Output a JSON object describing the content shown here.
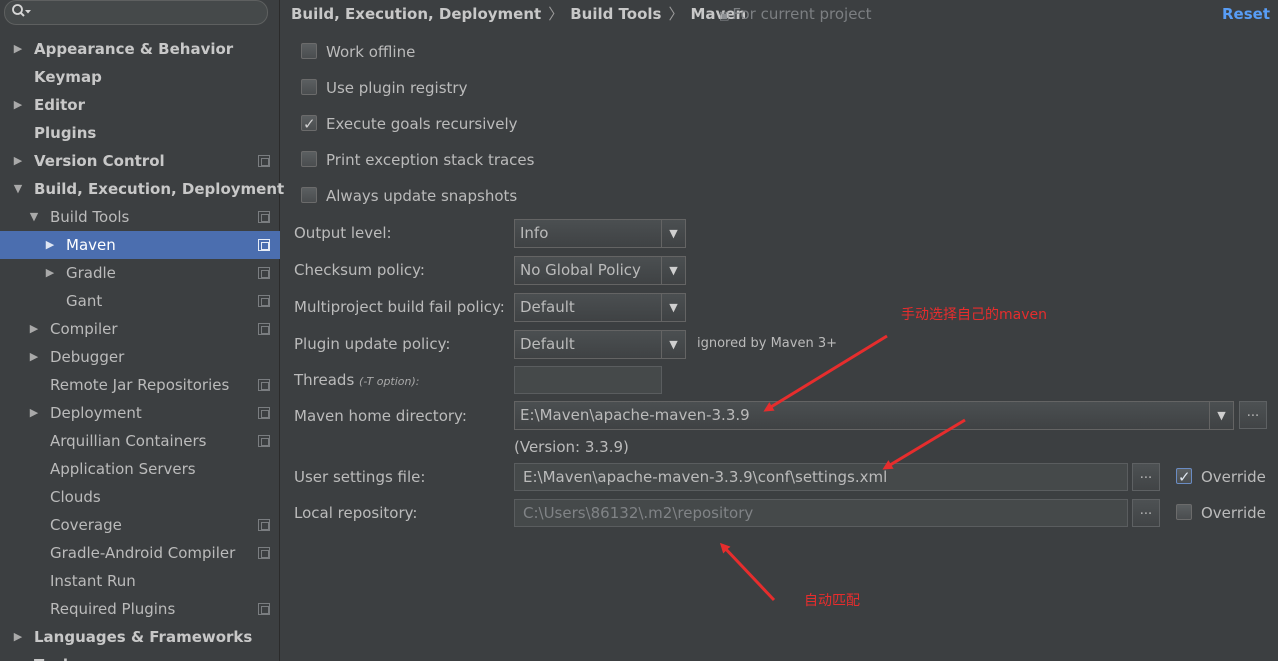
{
  "sidebar": {
    "search": {
      "value": ""
    },
    "items": [
      {
        "label": "Appearance & Behavior",
        "arrow": "▶",
        "bold": true
      },
      {
        "label": "Keymap",
        "arrow": "",
        "bold": true
      },
      {
        "label": "Editor",
        "arrow": "▶",
        "bold": true
      },
      {
        "label": "Plugins",
        "arrow": "",
        "bold": true
      },
      {
        "label": "Version Control",
        "arrow": "▶",
        "bold": true
      },
      {
        "label": "Build, Execution, Deployment",
        "arrow": "▼",
        "bold": true
      },
      {
        "label": "Build Tools",
        "arrow": "▼",
        "bold": false
      },
      {
        "label": "Maven",
        "arrow": "▶",
        "bold": false
      },
      {
        "label": "Gradle",
        "arrow": "▶",
        "bold": false
      },
      {
        "label": "Gant",
        "arrow": "",
        "bold": false
      },
      {
        "label": "Compiler",
        "arrow": "▶",
        "bold": false
      },
      {
        "label": "Debugger",
        "arrow": "▶",
        "bold": false
      },
      {
        "label": "Remote Jar Repositories",
        "arrow": "",
        "bold": false
      },
      {
        "label": "Deployment",
        "arrow": "▶",
        "bold": false
      },
      {
        "label": "Arquillian Containers",
        "arrow": "",
        "bold": false
      },
      {
        "label": "Application Servers",
        "arrow": "",
        "bold": false
      },
      {
        "label": "Clouds",
        "arrow": "",
        "bold": false
      },
      {
        "label": "Coverage",
        "arrow": "",
        "bold": false
      },
      {
        "label": "Gradle-Android Compiler",
        "arrow": "",
        "bold": false
      },
      {
        "label": "Instant Run",
        "arrow": "",
        "bold": false
      },
      {
        "label": "Required Plugins",
        "arrow": "",
        "bold": false
      },
      {
        "label": "Languages & Frameworks",
        "arrow": "▶",
        "bold": true
      },
      {
        "label": "Tools",
        "arrow": "▶",
        "bold": true
      }
    ],
    "selected_index": 7
  },
  "header": {
    "breadcrumb": [
      "Build, Execution, Deployment",
      "Build Tools",
      "Maven"
    ],
    "separator": "〉",
    "scope_icon": "project-scope-icon",
    "scope_text": "For current project",
    "reset_label": "Reset"
  },
  "options": {
    "work_offline": {
      "label": "Work offline",
      "checked": false
    },
    "use_plugin_registry": {
      "label": "Use plugin registry",
      "checked": false
    },
    "execute_goals_recursively": {
      "label": "Execute goals recursively",
      "checked": true
    },
    "print_exception_stack_traces": {
      "label": "Print exception stack traces",
      "checked": false
    },
    "always_update_snapshots": {
      "label": "Always update snapshots",
      "checked": false
    }
  },
  "form": {
    "output_level": {
      "label": "Output level:",
      "value": "Info"
    },
    "checksum_policy": {
      "label": "Checksum policy:",
      "value": "No Global Policy"
    },
    "multiproject_fail_policy": {
      "label": "Multiproject build fail policy:",
      "value": "Default"
    },
    "plugin_update_policy": {
      "label": "Plugin update policy:",
      "value": "Default",
      "note": "ignored by Maven 3+"
    },
    "threads": {
      "label": "Threads",
      "hint": "(-T option):",
      "value": ""
    },
    "maven_home": {
      "label": "Maven home directory:",
      "value": "E:\\Maven\\apache-maven-3.3.9",
      "version": "(Version: 3.3.9)",
      "browse": "..."
    },
    "user_settings": {
      "label": "User settings file:",
      "value": "E:\\Maven\\apache-maven-3.3.9\\conf\\settings.xml",
      "browse": "...",
      "override_label": "Override",
      "override_checked": true
    },
    "local_repository": {
      "label": "Local repository:",
      "value": "C:\\Users\\86132\\.m2\\repository",
      "browse": "...",
      "override_label": "Override",
      "override_checked": false
    }
  },
  "annotations": {
    "manual_select": "手动选择自己的maven",
    "auto_match": "自动匹配",
    "color": "#e62d2d"
  }
}
